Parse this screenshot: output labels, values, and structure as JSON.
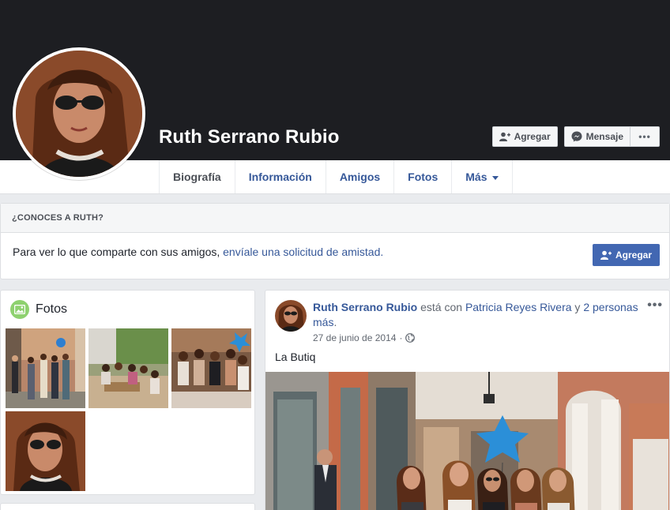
{
  "profile": {
    "name": "Ruth Serrano Rubio"
  },
  "cover_actions": {
    "add_friend_label": "Agregar",
    "message_label": "Mensaje",
    "more_label": "•••"
  },
  "tabs": [
    {
      "label": "Biografía"
    },
    {
      "label": "Información"
    },
    {
      "label": "Amigos"
    },
    {
      "label": "Fotos"
    },
    {
      "label": "Más"
    }
  ],
  "friend_prompt": {
    "header": "¿CONOCES A RUTH?",
    "text": "Para ver lo que comparte con sus amigos, ",
    "link_text": "envíale una solicitud de amistad",
    "suffix": ".",
    "button_label": "Agregar"
  },
  "photos": {
    "title": "Fotos"
  },
  "post": {
    "author": "Ruth Serrano Rubio",
    "with_text": " está con ",
    "tagged": "Patricia Reyes Rivera",
    "and_text": " y ",
    "others": "2 personas más",
    "end": ".",
    "date": "27 de junio de 2014",
    "separator": "·",
    "text": "La Butiq",
    "more_label": "•••"
  },
  "colors": {
    "cover": "#1d1e22",
    "link": "#365899",
    "primary_button": "#4267b2",
    "background": "#e9ebee"
  }
}
